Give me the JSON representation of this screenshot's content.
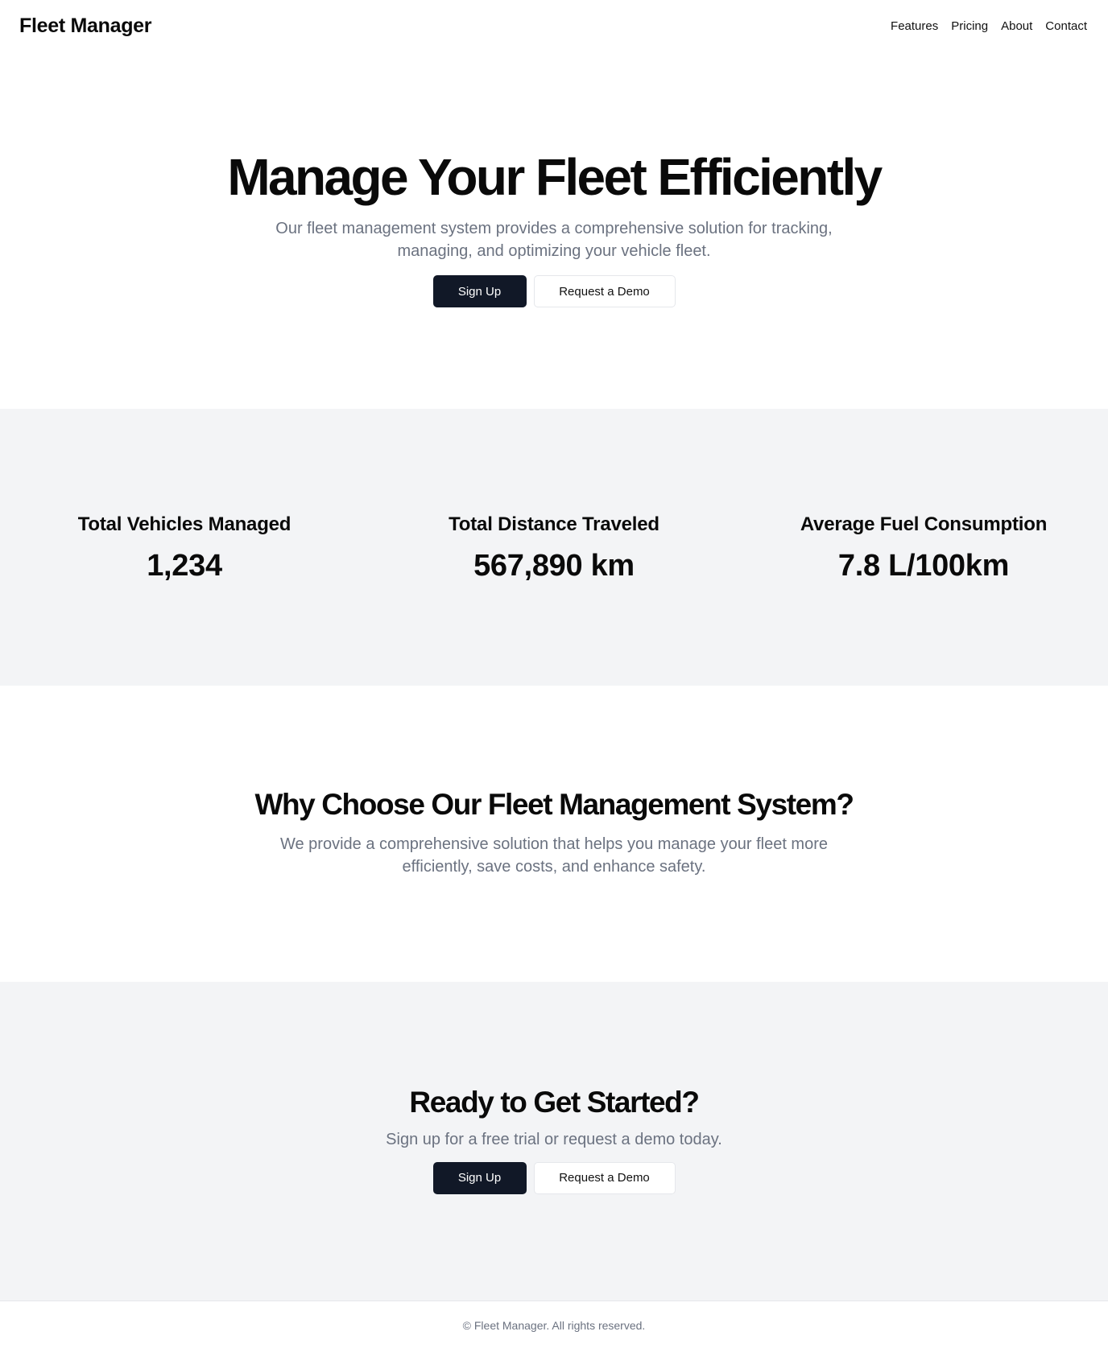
{
  "header": {
    "logo": "Fleet Manager",
    "nav": [
      "Features",
      "Pricing",
      "About",
      "Contact"
    ]
  },
  "hero": {
    "title": "Manage Your Fleet Efficiently",
    "subtitle": "Our fleet management system provides a comprehensive solution for tracking, managing, and optimizing your vehicle fleet.",
    "primary_button": "Sign Up",
    "secondary_button": "Request a Demo"
  },
  "stats": [
    {
      "label": "Total Vehicles Managed",
      "value": "1,234"
    },
    {
      "label": "Total Distance Traveled",
      "value": "567,890 km"
    },
    {
      "label": "Average Fuel Consumption",
      "value": "7.8 L/100km"
    }
  ],
  "why": {
    "title": "Why Choose Our Fleet Management System?",
    "subtitle": "We provide a comprehensive solution that helps you manage your fleet more efficiently, save costs, and enhance safety."
  },
  "cta": {
    "title": "Ready to Get Started?",
    "subtitle": "Sign up for a free trial or request a demo today.",
    "primary_button": "Sign Up",
    "secondary_button": "Request a Demo"
  },
  "footer": {
    "copyright": "© Fleet Manager. All rights reserved."
  },
  "colors": {
    "primary_button_bg": "#111827",
    "muted_text": "#6b7280",
    "section_bg": "#f3f4f6"
  }
}
